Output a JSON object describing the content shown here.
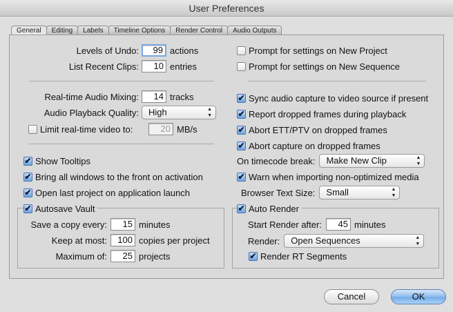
{
  "window": {
    "title": "User Preferences"
  },
  "tabs": [
    "General",
    "Editing",
    "Labels",
    "Timeline Options",
    "Render Control",
    "Audio Outputs"
  ],
  "left": {
    "levels_of_undo": {
      "label": "Levels of Undo:",
      "value": "99",
      "unit": "actions"
    },
    "list_recent_clips": {
      "label": "List Recent Clips:",
      "value": "10",
      "unit": "entries"
    },
    "realtime_audio_mixing": {
      "label": "Real-time Audio Mixing:",
      "value": "14",
      "unit": "tracks"
    },
    "audio_playback_quality": {
      "label": "Audio Playback Quality:",
      "value": "High"
    },
    "limit_realtime_video": {
      "label": "Limit real-time video to:",
      "value": "20",
      "unit": "MB/s",
      "checked": false
    },
    "show_tooltips": {
      "label": "Show Tooltips",
      "checked": true
    },
    "bring_windows_front": {
      "label": "Bring all windows to the front on activation",
      "checked": true
    },
    "open_last_project": {
      "label": "Open last project on application launch",
      "checked": true
    },
    "autosave": {
      "label": "Autosave Vault",
      "checked": true,
      "save_copy": {
        "label": "Save a copy every:",
        "value": "15",
        "unit": "minutes"
      },
      "keep_at_most": {
        "label": "Keep at most:",
        "value": "100",
        "unit": "copies per project"
      },
      "maximum_of": {
        "label": "Maximum of:",
        "value": "25",
        "unit": "projects"
      }
    }
  },
  "right": {
    "prompt_new_project": {
      "label": "Prompt for settings on New Project",
      "checked": false
    },
    "prompt_new_sequence": {
      "label": "Prompt for settings on New Sequence",
      "checked": false
    },
    "sync_audio_capture": {
      "label": "Sync audio capture to video source if present",
      "checked": true
    },
    "report_dropped_frames": {
      "label": "Report dropped frames during playback",
      "checked": true
    },
    "abort_ett_ptv": {
      "label": "Abort ETT/PTV on dropped frames",
      "checked": true
    },
    "abort_capture": {
      "label": "Abort capture on dropped frames",
      "checked": true
    },
    "on_timecode_break": {
      "label": "On timecode break:",
      "value": "Make New Clip"
    },
    "warn_non_optimized": {
      "label": "Warn when importing non-optimized media",
      "checked": true
    },
    "browser_text_size": {
      "label": "Browser Text Size:",
      "value": "Small"
    },
    "auto_render": {
      "label": "Auto Render",
      "checked": true,
      "start_after": {
        "label": "Start Render after:",
        "value": "45",
        "unit": "minutes"
      },
      "render": {
        "label": "Render:",
        "value": "Open Sequences"
      },
      "rt_segments": {
        "label": "Render RT Segments",
        "checked": true
      }
    }
  },
  "buttons": {
    "cancel": "Cancel",
    "ok": "OK"
  },
  "icons": {
    "checkmark": "✔",
    "popup_arrows": "▲▼"
  }
}
